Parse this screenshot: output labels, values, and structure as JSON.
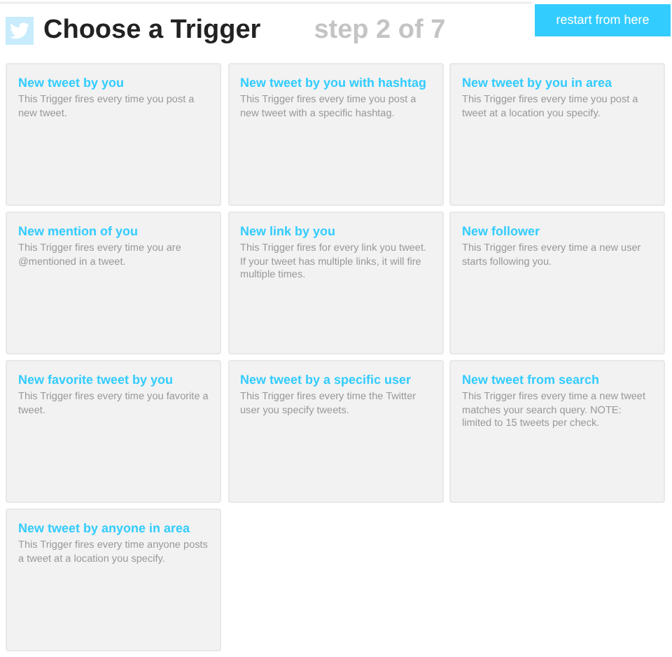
{
  "header": {
    "title": "Choose a Trigger",
    "step": "step 2 of 7",
    "button": "restart from here"
  },
  "triggers": [
    {
      "title": "New tweet by you",
      "description": "This Trigger fires every time you post a new tweet."
    },
    {
      "title": "New tweet by you with hashtag",
      "description": "This Trigger fires every time you post a new tweet with a specific hashtag."
    },
    {
      "title": "New tweet by you in area",
      "description": "This Trigger fires every time you post a tweet at a location you specify."
    },
    {
      "title": "New mention of you",
      "description": "This Trigger fires every time you are @mentioned in a tweet."
    },
    {
      "title": "New link by you",
      "description": "This Trigger fires for every link you tweet. If your tweet has multiple links, it will fire multiple times."
    },
    {
      "title": "New follower",
      "description": "This Trigger fires every time a new user starts following you."
    },
    {
      "title": "New favorite tweet by you",
      "description": "This Trigger fires every time you favorite a tweet."
    },
    {
      "title": "New tweet by a specific user",
      "description": "This Trigger fires every time the Twitter user you specify tweets."
    },
    {
      "title": "New tweet from search",
      "description": "This Trigger fires every time a new tweet matches your search query. NOTE: limited to 15 tweets per check."
    },
    {
      "title": "New tweet by anyone in area",
      "description": "This Trigger fires every time anyone posts a tweet at a location you specify."
    }
  ]
}
